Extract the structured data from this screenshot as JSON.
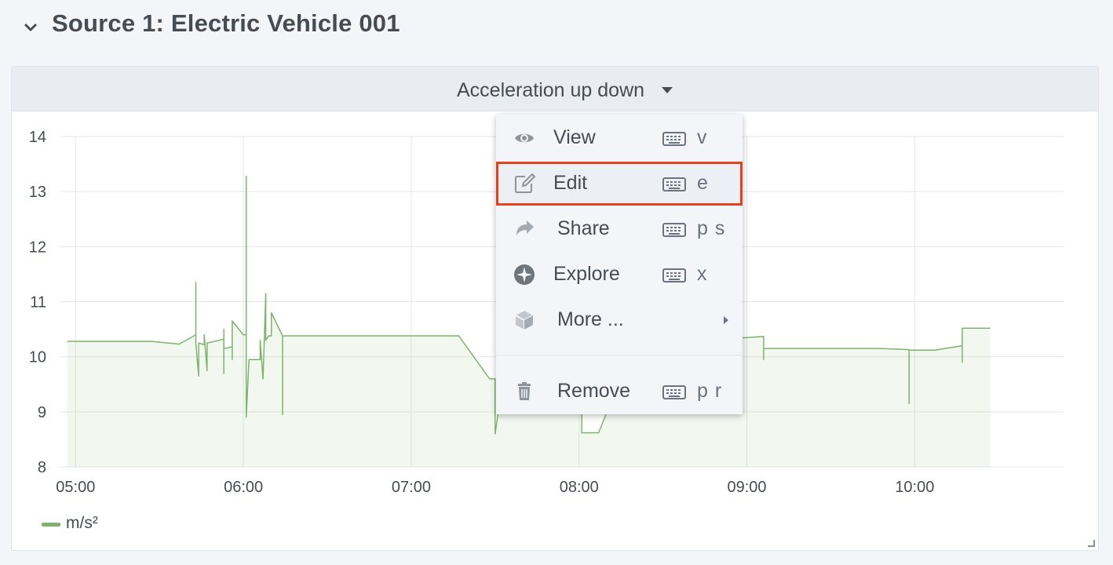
{
  "row": {
    "title": "Source 1: Electric Vehicle 001",
    "chevron_icon": "chevron-down-icon"
  },
  "panel": {
    "title": "Acceleration up down",
    "caret_icon": "caret-down-icon"
  },
  "menu": {
    "items": [
      {
        "label": "View",
        "icon": "eye-icon",
        "shortcut": "v"
      },
      {
        "label": "Edit",
        "icon": "edit-icon",
        "shortcut": "e",
        "highlighted": true
      },
      {
        "label": "Share",
        "icon": "share-icon",
        "shortcut": "p s"
      },
      {
        "label": "Explore",
        "icon": "compass-icon",
        "shortcut": "x"
      },
      {
        "label": "More ...",
        "icon": "cube-icon",
        "submenu": true
      },
      {
        "label": "Remove",
        "icon": "trash-icon",
        "shortcut": "p r"
      }
    ]
  },
  "legend": {
    "label": "m/s²",
    "color": "#7eb26d"
  },
  "chart_data": {
    "type": "area",
    "x_labels": [
      "05:00",
      "06:00",
      "07:00",
      "08:00",
      "09:00",
      "10:00"
    ],
    "y_ticks": [
      8,
      9,
      10,
      11,
      12,
      13,
      14
    ],
    "ylim": [
      8,
      14
    ],
    "xlim": [
      "04:57",
      "10:50"
    ],
    "grid": true,
    "legend_position": "bottom-left",
    "series": [
      {
        "name": "m/s²",
        "color": "#7eb26d",
        "points": [
          [
            "04:57",
            10.28
          ],
          [
            "05:27",
            10.28
          ],
          [
            "05:37",
            10.23
          ],
          [
            "05:43",
            10.4
          ],
          [
            "05:43",
            11.35
          ],
          [
            "05:43",
            10.25
          ],
          [
            "05:44",
            9.65
          ],
          [
            "05:44",
            10.25
          ],
          [
            "05:46",
            10.22
          ],
          [
            "05:46",
            10.4
          ],
          [
            "05:47",
            9.75
          ],
          [
            "05:47",
            10.25
          ],
          [
            "05:53",
            10.32
          ],
          [
            "05:53",
            10.5
          ],
          [
            "05:53",
            9.7
          ],
          [
            "05:53",
            10.15
          ],
          [
            "05:56",
            10.18
          ],
          [
            "05:56",
            9.95
          ],
          [
            "05:56",
            10.65
          ],
          [
            "06:00",
            10.4
          ],
          [
            "06:01",
            10.4
          ],
          [
            "06:01",
            13.28
          ],
          [
            "06:01",
            8.9
          ],
          [
            "06:02",
            9.95
          ],
          [
            "06:06",
            9.95
          ],
          [
            "06:06",
            10.3
          ],
          [
            "06:07",
            9.6
          ],
          [
            "06:08",
            11.15
          ],
          [
            "06:08",
            10.3
          ],
          [
            "06:09",
            10.38
          ],
          [
            "06:10",
            10.38
          ],
          [
            "06:10",
            10.8
          ],
          [
            "06:14",
            10.38
          ],
          [
            "06:14",
            8.95
          ],
          [
            "06:14",
            10.38
          ],
          [
            "07:17",
            10.38
          ],
          [
            "07:28",
            9.6
          ],
          [
            "07:30",
            9.6
          ],
          [
            "07:30",
            8.6
          ],
          [
            "07:32",
            9.3
          ],
          [
            "07:58",
            9.3
          ],
          [
            "08:01",
            9.6
          ],
          [
            "08:01",
            8.62
          ],
          [
            "08:07",
            8.62
          ],
          [
            "08:10",
            9.0
          ],
          [
            "08:51",
            10.32
          ],
          [
            "09:06",
            10.37
          ],
          [
            "09:06",
            9.95
          ],
          [
            "09:06",
            10.15
          ],
          [
            "09:48",
            10.15
          ],
          [
            "09:58",
            10.13
          ],
          [
            "09:58",
            9.15
          ],
          [
            "09:58",
            10.12
          ],
          [
            "10:07",
            10.12
          ],
          [
            "10:17",
            10.2
          ],
          [
            "10:17",
            9.9
          ],
          [
            "10:17",
            10.52
          ],
          [
            "10:27",
            10.52
          ]
        ]
      }
    ]
  }
}
